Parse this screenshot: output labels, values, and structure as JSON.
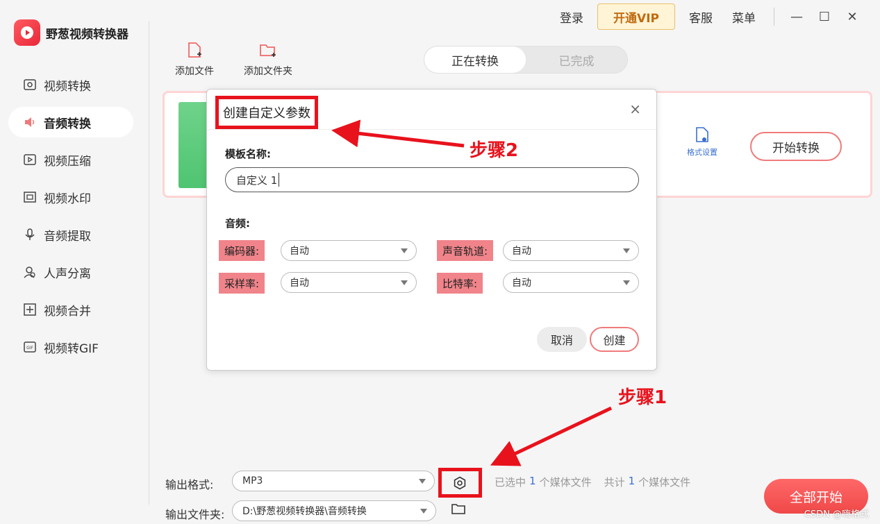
{
  "app": {
    "title": "野葱视频转换器"
  },
  "topbar": {
    "login": "登录",
    "vip": "开通VIP",
    "service": "客服",
    "menu": "菜单",
    "minimize": "—",
    "maximize": "☐",
    "close": "✕"
  },
  "sidebar": {
    "items": [
      {
        "label": "视频转换",
        "icon": "video-convert-icon",
        "active": false
      },
      {
        "label": "音频转换",
        "icon": "audio-convert-icon",
        "active": true
      },
      {
        "label": "视频压缩",
        "icon": "video-compress-icon",
        "active": false
      },
      {
        "label": "视频水印",
        "icon": "watermark-icon",
        "active": false
      },
      {
        "label": "音频提取",
        "icon": "audio-extract-icon",
        "active": false
      },
      {
        "label": "人声分离",
        "icon": "voice-separate-icon",
        "active": false
      },
      {
        "label": "视频合并",
        "icon": "video-merge-icon",
        "active": false
      },
      {
        "label": "视频转GIF",
        "icon": "gif-icon",
        "active": false
      }
    ]
  },
  "toolbar": {
    "add_file": "添加文件",
    "add_folder": "添加文件夹"
  },
  "tabs": {
    "converting": "正在转换",
    "completed": "已完成"
  },
  "file_card": {
    "format_settings": "格式设置",
    "start": "开始转换"
  },
  "dialog": {
    "title": "创建自定义参数",
    "close": "×",
    "template_name_label": "模板名称:",
    "template_name_value": "自定义 1",
    "audio_section": "音频:",
    "encoder_label": "编码器:",
    "encoder_value": "自动",
    "channels_label": "声音轨道:",
    "channels_value": "自动",
    "sample_rate_label": "采样率:",
    "sample_rate_value": "自动",
    "bitrate_label": "比特率:",
    "bitrate_value": "自动",
    "cancel": "取消",
    "create": "创建"
  },
  "annotations": {
    "step1": "步骤1",
    "step2": "步骤2"
  },
  "bottom": {
    "output_format_label": "输出格式:",
    "output_format_value": "MP3",
    "output_folder_label": "输出文件夹:",
    "output_folder_value": "D:\\野葱视频转换器\\音频转换",
    "selected_prefix": "已选中",
    "selected_count": "1",
    "selected_suffix": "个媒体文件",
    "total_prefix": "共计",
    "total_count": "1",
    "total_suffix": "个媒体文件",
    "start_all": "全部开始"
  },
  "watermark": "CSDN @嗨格式",
  "colors": {
    "accent": "#f04848",
    "annotation": "#e8121c",
    "link": "#3a6fd0"
  }
}
